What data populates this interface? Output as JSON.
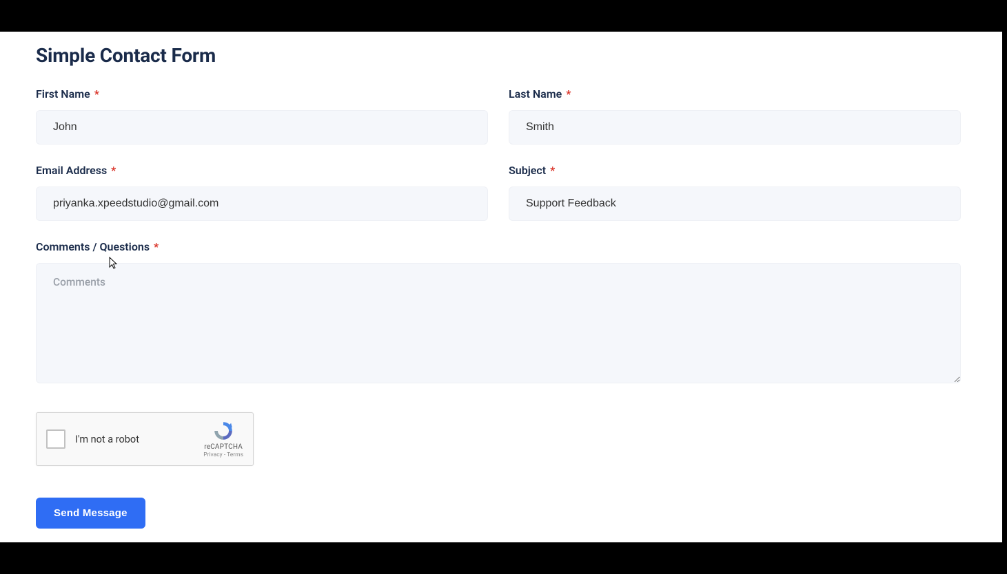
{
  "page": {
    "title": "Simple Contact Form"
  },
  "form": {
    "first_name": {
      "label": "First Name",
      "value": "John"
    },
    "last_name": {
      "label": "Last Name",
      "value": "Smith"
    },
    "email": {
      "label": "Email Address",
      "value": "priyanka.xpeedstudio@gmail.com"
    },
    "subject": {
      "label": "Subject",
      "value": "Support Feedback"
    },
    "comments": {
      "label": "Comments / Questions",
      "placeholder": "Comments",
      "value": ""
    },
    "required_star": "*"
  },
  "recaptcha": {
    "label": "I'm not a robot",
    "brand": "reCAPTCHA",
    "links": "Privacy - Terms"
  },
  "submit": {
    "label": "Send Message"
  },
  "colors": {
    "accent": "#2f6df4",
    "field_bg": "#f5f7fb",
    "required": "#d93025"
  }
}
